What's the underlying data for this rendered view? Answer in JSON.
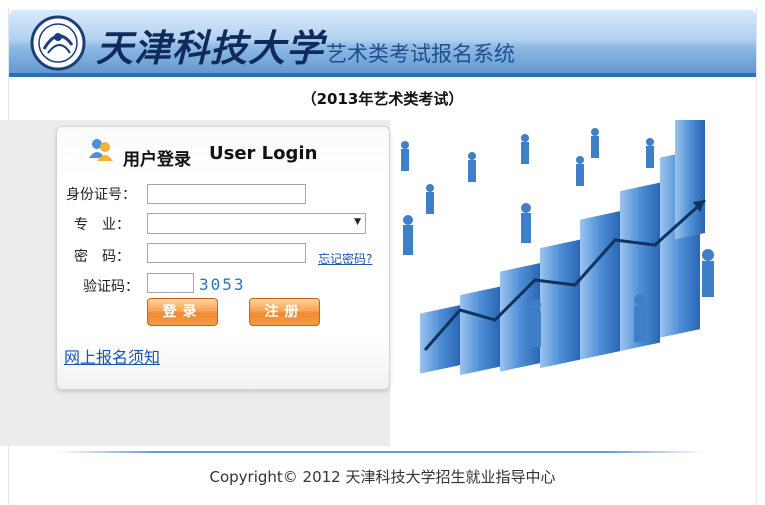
{
  "header": {
    "school_name": "天津科技大学",
    "system_title": "艺术类考试报名系统"
  },
  "exam_title": "（2013年艺术类考试）",
  "login": {
    "title_cn": "用户登录",
    "title_en": "User Login",
    "id_label": "身份证号：",
    "id_value": "",
    "major_label": "专　业：",
    "major_selected": "",
    "password_label": "密　码：",
    "password_value": "",
    "forgot_link": "忘记密码?",
    "captcha_label": "验证码：",
    "captcha_value": "",
    "captcha_code": "3053",
    "login_button": "登录",
    "register_button": "注册",
    "notice_link": "网上报名须知"
  },
  "footer": {
    "copyright": "Copyright© 2012 天津科技大学招生就业指导中心"
  },
  "colors": {
    "header_blue": "#5d95cf",
    "button_orange": "#f49a43",
    "link_blue": "#1a55b0",
    "captcha_blue": "#2c73b9"
  },
  "icons": [
    "university-logo-icon",
    "users-icon",
    "chevron-down-icon"
  ]
}
